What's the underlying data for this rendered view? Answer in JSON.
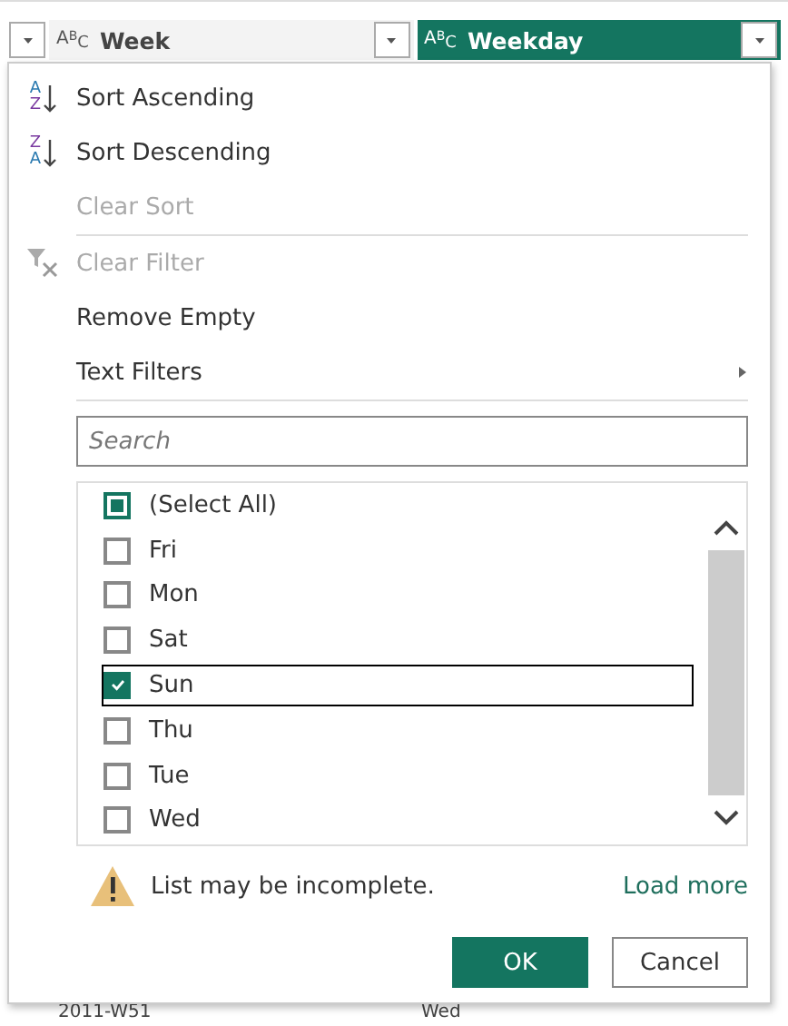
{
  "columns": [
    {
      "type_label": "A$^{B}$$_{C}$",
      "name": "Week",
      "selected": false
    },
    {
      "type_label": "A$^{B}$$_{C}$",
      "name": "Weekday",
      "selected": true
    }
  ],
  "menu": [
    {
      "kind": "sort-asc",
      "label": "Sort Ascending",
      "disabled": false,
      "icon_letters": [
        "A",
        "Z"
      ]
    },
    {
      "kind": "sort-desc",
      "label": "Sort Descending",
      "disabled": false,
      "icon_letters": [
        "Z",
        "A"
      ]
    },
    {
      "kind": "plain",
      "label": "Clear Sort",
      "disabled": true
    },
    {
      "kind": "separator"
    },
    {
      "kind": "clear-filter",
      "label": "Clear Filter",
      "disabled": true
    },
    {
      "kind": "plain",
      "label": "Remove Empty",
      "disabled": false
    },
    {
      "kind": "submenu",
      "label": "Text Filters",
      "disabled": false
    },
    {
      "kind": "separator"
    }
  ],
  "search": {
    "placeholder": "Search"
  },
  "values": [
    {
      "label": "(Select All)",
      "checked": false,
      "partial": true,
      "focused": false
    },
    {
      "label": "Fri",
      "checked": false,
      "partial": false,
      "focused": false
    },
    {
      "label": "Mon",
      "checked": false,
      "partial": false,
      "focused": false
    },
    {
      "label": "Sat",
      "checked": false,
      "partial": false,
      "focused": false
    },
    {
      "label": "Sun",
      "checked": true,
      "partial": false,
      "focused": true
    },
    {
      "label": "Thu",
      "checked": false,
      "partial": false,
      "focused": false
    },
    {
      "label": "Tue",
      "checked": false,
      "partial": false,
      "focused": false
    },
    {
      "label": "Wed",
      "checked": false,
      "partial": false,
      "focused": false
    }
  ],
  "warning": {
    "text": "List may be incomplete.",
    "link": "Load more"
  },
  "buttons": [
    {
      "label": "OK",
      "primary": true
    },
    {
      "label": "Cancel",
      "primary": false
    }
  ],
  "bottom_row": [
    "2011-W51",
    "Wed"
  ]
}
